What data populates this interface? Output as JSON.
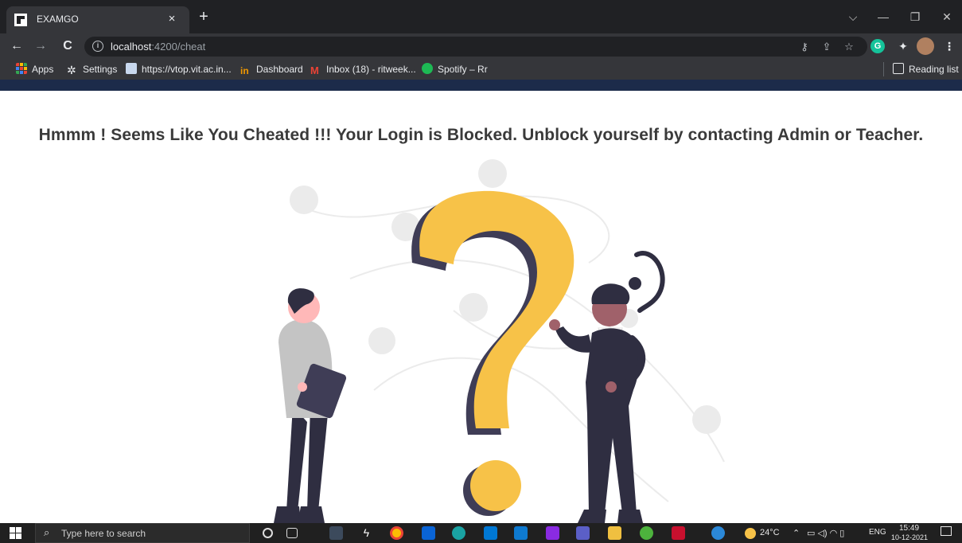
{
  "browser": {
    "tab_title": "EXAMGO",
    "tab_close": "×",
    "new_tab": "+",
    "window_controls": {
      "dropdown": "⌵",
      "minimize": "—",
      "restore": "❐",
      "close": "✕"
    },
    "nav": {
      "back": "←",
      "forward": "→",
      "reload": "C"
    },
    "url_host": "localhost",
    "url_path": ":4200/cheat",
    "info_icon": "i",
    "bookmarks": [
      {
        "label": "Apps",
        "icon": "apps-grid-icon",
        "color": "#ea4335"
      },
      {
        "label": "Settings",
        "icon": "gear-icon",
        "color": "#e8eaed"
      },
      {
        "label": "https://vtop.vit.ac.in...",
        "icon": "vtop-favicon-icon",
        "color": "#8ab4f8"
      },
      {
        "label": "Dashboard",
        "icon": "dashboard-favicon-icon",
        "color": "#f29900"
      },
      {
        "label": "Inbox (18) - ritweek...",
        "icon": "gmail-icon",
        "color": "#ea4335"
      },
      {
        "label": "Spotify – Rr",
        "icon": "spotify-icon",
        "color": "#1db954"
      }
    ],
    "reading_list": "Reading list"
  },
  "page": {
    "message": "Hmmm ! Seems Like You Cheated !!! Your Login is Blocked. Unblock yourself by contacting Admin or Teacher.",
    "colors": {
      "question_mark": "#f7c248",
      "dark": "#3f3d56",
      "figure_dark": "#2f2e41",
      "skin_light": "#ffb8b8",
      "skin_dark": "#a0616a",
      "shirt": "#c4c4c4",
      "bubble": "#ebebeb"
    }
  },
  "taskbar": {
    "search_placeholder": "Type here to search",
    "weather": "24°C",
    "language": "ENG",
    "time": "15:49",
    "date": "10-12-2021"
  }
}
